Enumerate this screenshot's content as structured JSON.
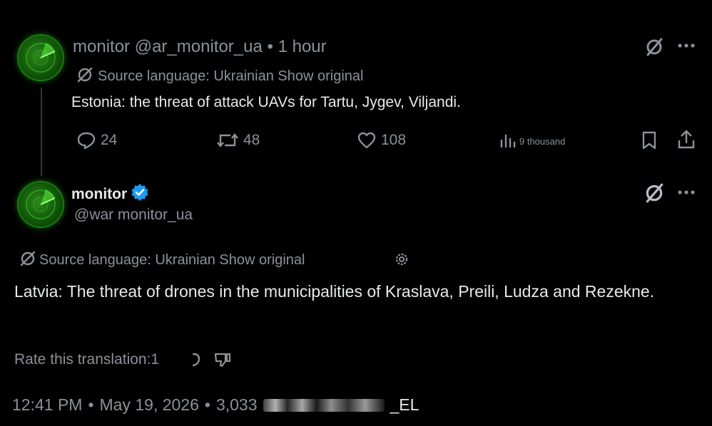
{
  "post1": {
    "display_name": "monitor",
    "handle": "@ar_monitor_ua",
    "separator": "•",
    "time": "1 hour",
    "source_language": "Source language: Ukrainian Show original",
    "text": "Estonia: the threat of attack UAVs for Tartu, Jygev, Viljandi.",
    "replies": "24",
    "reposts": "48",
    "likes": "108",
    "views": "9 thousand"
  },
  "post2": {
    "display_name": "monitor",
    "handle": "@war monitor_ua",
    "source_language": "Source language: Ukrainian Show original",
    "text": "Latvia: The threat of drones in the municipalities of Kraslava, Preili, Ludza and Rezekne.",
    "rate_label": "Rate this translation:1",
    "footer_time": "12:41 PM",
    "footer_date": "May 19, 2026",
    "footer_views": "3,033",
    "footer_sep": "•",
    "watermark": "_EL"
  },
  "colors": {
    "background": "#000000",
    "text": "#e7e9ea",
    "muted": "#8b9199",
    "verified": "#1d9bf0",
    "avatar_green": "#1e9a12"
  }
}
